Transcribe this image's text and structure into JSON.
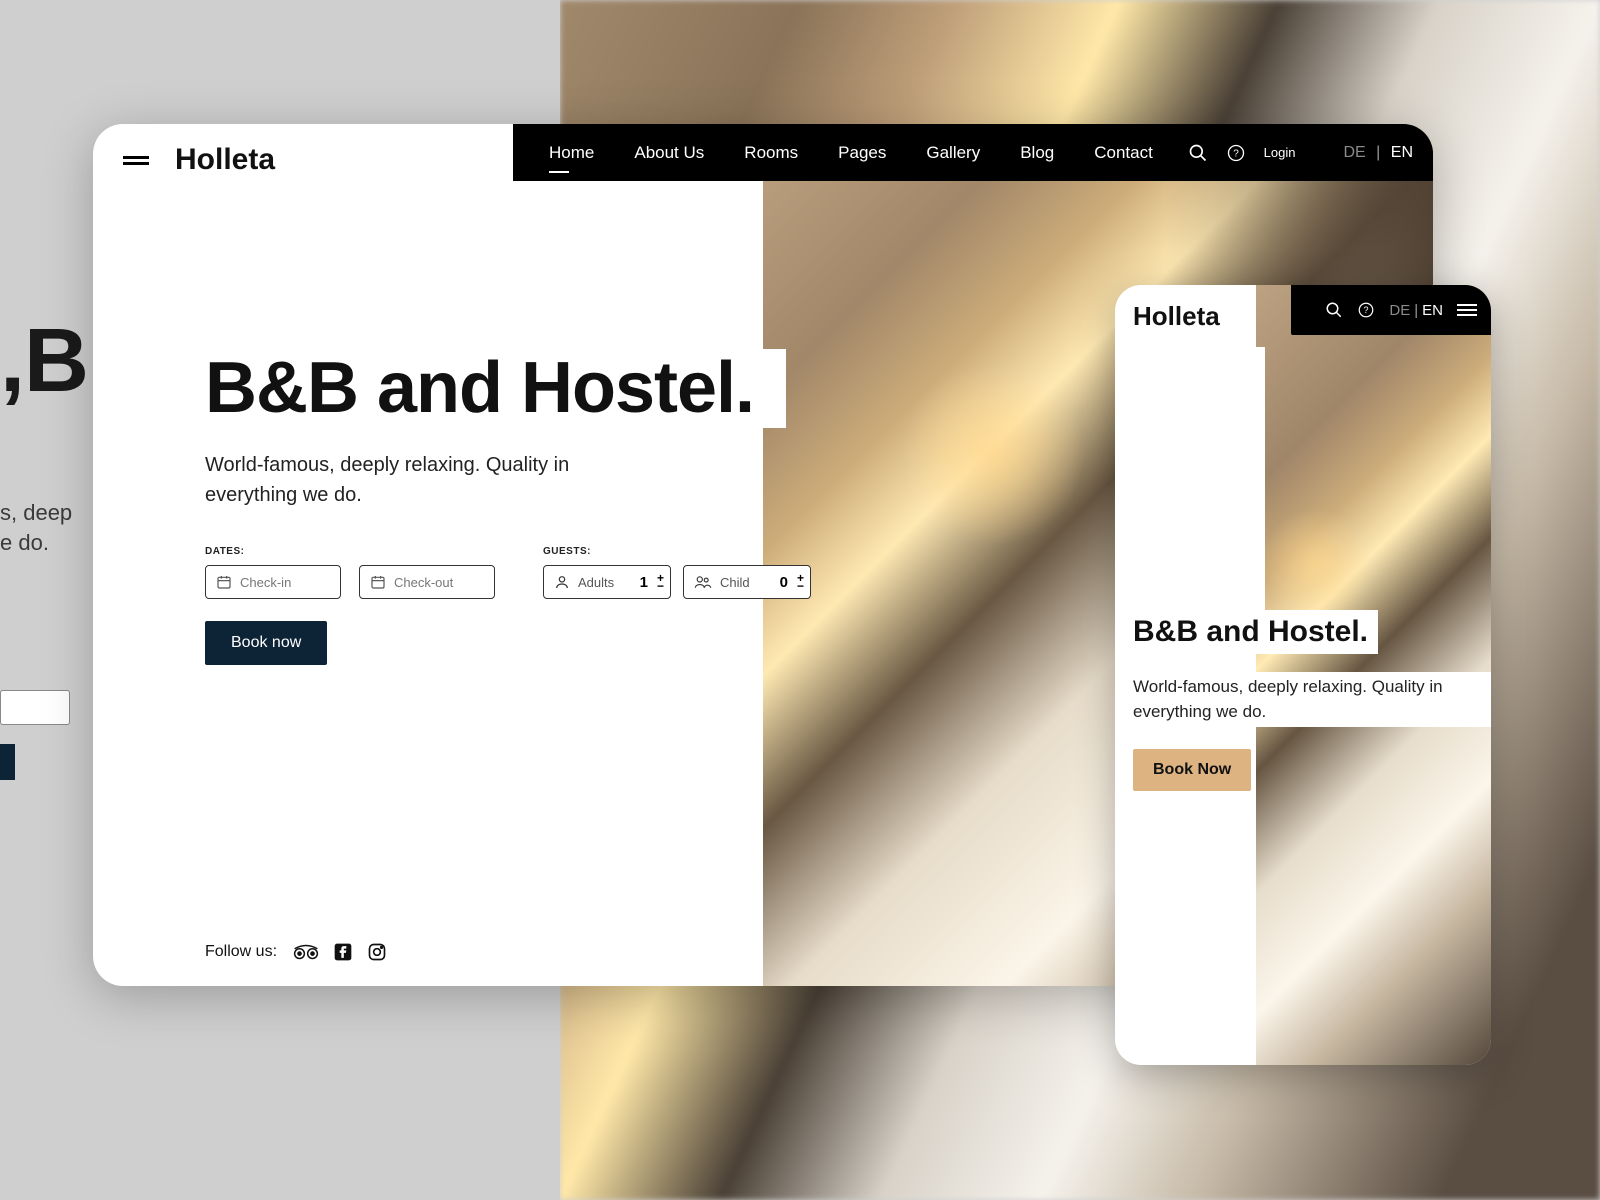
{
  "brand": "Holleta",
  "nav": {
    "items": [
      "Home",
      "About Us",
      "Rooms",
      "Pages",
      "Gallery",
      "Blog",
      "Contact"
    ],
    "active": "Home",
    "login": "Login",
    "lang_inactive": "DE",
    "lang_active": "EN",
    "lang_sep": "|"
  },
  "hero": {
    "headline": "B&B and Hostel.",
    "subtext_line1": "World-famous, deeply relaxing. Quality in",
    "subtext_line2": "everything we do.",
    "dates_label": "DATES:",
    "guests_label": "GUESTS:",
    "checkin_ph": "Check-in",
    "checkout_ph": "Check-out",
    "adults_label": "Adults",
    "adults_value": "1",
    "child_label": "Child",
    "child_value": "0",
    "book_btn": "Book now",
    "plus": "+",
    "minus": "−"
  },
  "footer": {
    "follow": "Follow us:"
  },
  "mobile": {
    "brand": "Holleta",
    "headline": "B&B and Hostel.",
    "subtext": "World-famous, deeply relaxing. Quality in everything we do.",
    "book_btn": "Book Now",
    "lang_inactive": "DE",
    "lang_active": "EN",
    "lang_sep": "|"
  },
  "faded": {
    "title": ",B",
    "sub": "s, deep",
    "sub2": "e do."
  }
}
